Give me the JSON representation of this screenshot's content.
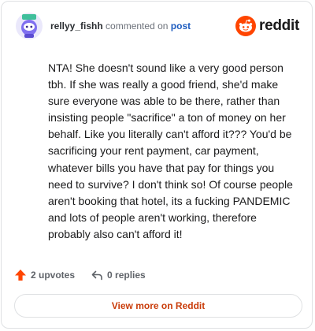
{
  "header": {
    "username": "rellyy_fishh",
    "commented_on": "commented on",
    "post_link": "post",
    "brand": "reddit"
  },
  "comment": {
    "text": "NTA! She doesn't sound like a very good person tbh. If she was really a good friend, she'd make sure everyone was able to be there, rather than insisting people \"sacrifice\" a ton of money on her behalf. Like you literally can't afford it??? You'd be sacrificing your rent payment, car payment, whatever bills you have that pay for things you need to survive? I don't think so! Of course people aren't booking that hotel, its a fucking PANDEMIC and lots of people aren't working, therefore probably also can't afford it!"
  },
  "actions": {
    "upvotes": "2 upvotes",
    "replies": "0 replies"
  },
  "footer": {
    "view_more": "View more on Reddit"
  },
  "colors": {
    "accent": "#c93c0a",
    "upvote": "#ff4500",
    "link": "#1c5bbf",
    "avatar_bg": "#7f6ff0"
  },
  "icons": {
    "avatar": "snoo-avatar-icon",
    "brand": "reddit-logo-icon",
    "upvote": "upvote-arrow-icon",
    "reply": "reply-arrow-icon"
  }
}
